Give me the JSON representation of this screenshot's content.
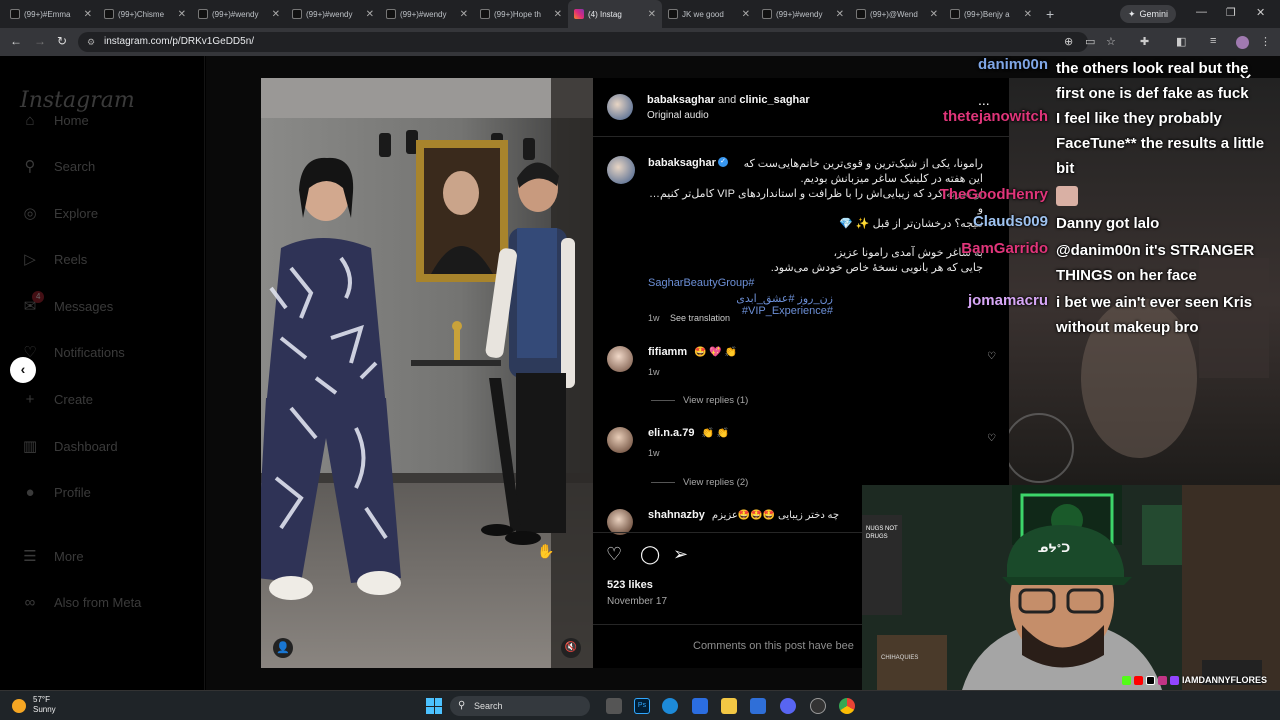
{
  "browser": {
    "tabs": [
      {
        "label": "(99+)#Emma"
      },
      {
        "label": "(99+)Chisme"
      },
      {
        "label": "(99+)#wendy"
      },
      {
        "label": "(99+)#wendy"
      },
      {
        "label": "(99+)#wendy"
      },
      {
        "label": "(99+)Hope th"
      },
      {
        "label": "(4) Instag",
        "active": true
      },
      {
        "label": "JK we good"
      },
      {
        "label": "(99+)#wendy"
      },
      {
        "label": "(99+)@Wend"
      },
      {
        "label": "(99+)Benjy a"
      }
    ],
    "new_tab": "+",
    "gemini_label": "Gemini",
    "url": "instagram.com/p/DRKv1GeDD5n/"
  },
  "sidebar": {
    "logo": "Instagram",
    "items": [
      {
        "label": "Home",
        "icon": "home-icon",
        "glyph": "⌂"
      },
      {
        "label": "Search",
        "icon": "search-icon",
        "glyph": "⚲"
      },
      {
        "label": "Explore",
        "icon": "compass-icon",
        "glyph": "◎"
      },
      {
        "label": "Reels",
        "icon": "reels-icon",
        "glyph": "▷"
      },
      {
        "label": "Messages",
        "icon": "messenger-icon",
        "glyph": "✉",
        "badge": "4"
      },
      {
        "label": "Notifications",
        "icon": "heart-icon",
        "glyph": "♡"
      },
      {
        "label": "Create",
        "icon": "plus-icon",
        "glyph": "+"
      },
      {
        "label": "Dashboard",
        "icon": "dashboard-icon",
        "glyph": "▥"
      },
      {
        "label": "Profile",
        "icon": "avatar-icon",
        "glyph": "●"
      },
      {
        "label": "More",
        "icon": "menu-icon",
        "glyph": "☰"
      },
      {
        "label": "Also from Meta",
        "icon": "meta-icon",
        "glyph": "∞"
      }
    ]
  },
  "post": {
    "header_user": "babaksaghar",
    "header_and": "and",
    "header_collab": "clinic_saghar",
    "audio": "Original audio",
    "more": "...",
    "caption_user": "babaksaghar",
    "caption_lines": [
      "رامونا، یکی از شیک‌ترین و قوی‌ترین خانم‌هایی‌ست که",
      "این هفته در کلینیک ساغر میزبانش بودیم.",
      "او تجربه کرد که زیبایی‌اش را با ظرافت و استانداردهای VIP کامل‌تر کنیم… و",
      "نتیجه؟ درخشان‌تر از قبل ✨ 💎"
    ],
    "caption_lines2": [
      "به ساغر خوش آمدی رامونا عزیز،",
      "جایی که هر بانویی نسخهٔ خاص خودش می‌شود."
    ],
    "hashtags_line1": "SagharBeautyGroup#",
    "hashtags_line2": "زن_روز #عشق_ابدی #VIP_Experience#",
    "caption_time": "1w",
    "see_translation": "See translation",
    "comments": [
      {
        "user": "fifiamm",
        "text": "🤩 💖 👏",
        "time": "1w",
        "replies": "View replies (1)"
      },
      {
        "user": "eli.n.a.79",
        "text": "👏 👏",
        "time": "1w",
        "replies": "View replies (2)"
      },
      {
        "user": "shahnazby",
        "text": "چه دختر زیبایی 🤩🤩🤩عزیزم"
      }
    ],
    "likes": "523 likes",
    "date": "November 17",
    "comments_off": "Comments on this post have bee"
  },
  "chat": [
    {
      "user": "danim00n",
      "msg": "the others look real but the first one is def fake as fuck",
      "user_color": "#7fa6e6"
    },
    {
      "user": "thetejanowitch",
      "msg": "I feel like they probably FaceTune** the results a little bit",
      "user_color": "#e0357a"
    },
    {
      "user": "TheGoodHenry",
      "msg": "",
      "user_color": "#e0357a"
    },
    {
      "user": "Clauds009",
      "msg": "Danny got lalo",
      "user_color": "#9fc3f0"
    },
    {
      "user": "BamGarrido",
      "msg": "@danim00n it's STRANGER THINGS on her face",
      "user_color": "#e0357a"
    },
    {
      "user": "jomamacru",
      "msg": "i bet we ain't ever seen Kris without makeup bro",
      "user_color": "#d6a6f5"
    }
  ],
  "webcam": {
    "hat_text": "ᓄᔭᐤᑐ",
    "sign_text": "NUGS NOT DRUGS",
    "bag_text": "CHIHAQUIES",
    "watermark": "IAMDANNYFLORES"
  },
  "taskbar": {
    "temp": "57°F",
    "weather": "Sunny",
    "search": "Search"
  }
}
